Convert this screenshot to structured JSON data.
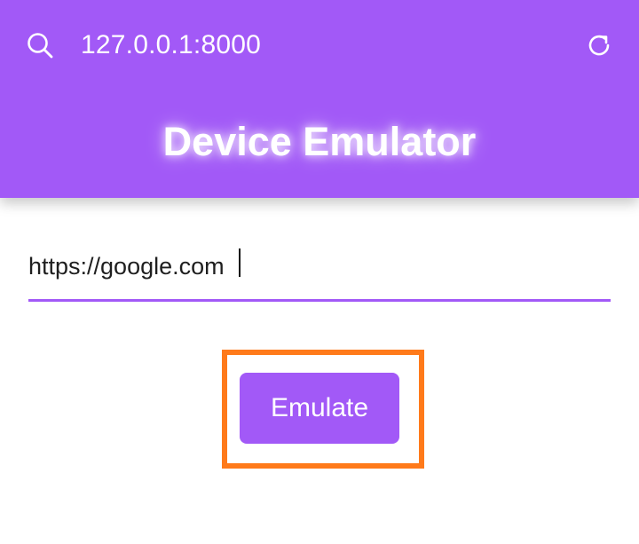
{
  "browser": {
    "url": "127.0.0.1:8000",
    "icons": {
      "search": "search-icon",
      "refresh": "refresh-icon"
    }
  },
  "header": {
    "title": "Device Emulator"
  },
  "form": {
    "url_value": "https://google.com",
    "emulate_label": "Emulate"
  },
  "colors": {
    "accent": "#a259f7",
    "highlight": "#ff7a1a",
    "background": "#ffffff"
  }
}
